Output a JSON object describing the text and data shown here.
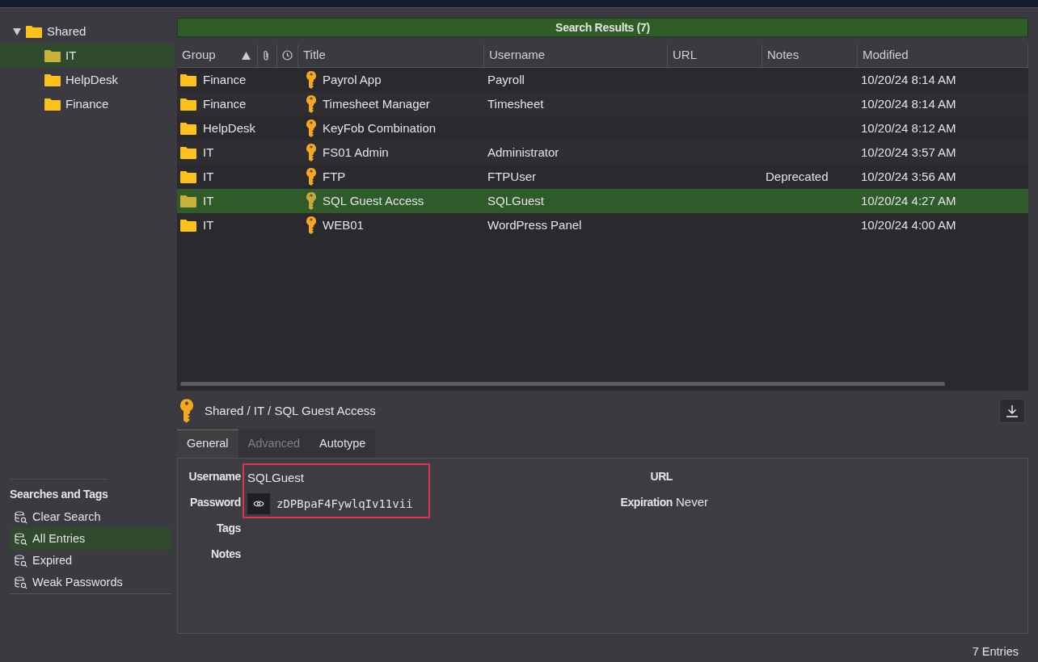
{
  "groups": [
    {
      "name": "Shared",
      "selected": false,
      "expanded": true,
      "children": [
        {
          "name": "IT",
          "selected": true
        },
        {
          "name": "HelpDesk",
          "selected": false
        },
        {
          "name": "Finance",
          "selected": false
        }
      ]
    }
  ],
  "searches": {
    "title": "Searches and Tags",
    "items": [
      {
        "label": "Clear Search",
        "selected": false
      },
      {
        "label": "All Entries",
        "selected": true
      },
      {
        "label": "Expired",
        "selected": false
      },
      {
        "label": "Weak Passwords",
        "selected": false
      }
    ]
  },
  "search_results": {
    "title": "Search Results (7)"
  },
  "table": {
    "columns": [
      {
        "kind": "text",
        "label": "Group",
        "sorted": true
      },
      {
        "kind": "attachment"
      },
      {
        "kind": "clock"
      },
      {
        "kind": "text",
        "label": "Title",
        "sorted": false
      },
      {
        "kind": "text",
        "label": "Username",
        "sorted": false
      },
      {
        "kind": "text",
        "label": "URL",
        "sorted": false
      },
      {
        "kind": "text",
        "label": "Notes",
        "sorted": false
      },
      {
        "kind": "text",
        "label": "Modified",
        "sorted": false
      }
    ],
    "rows": [
      {
        "group": "Finance",
        "title": "Payrol App",
        "username": "Payroll",
        "modified": "10/20/24 8:14 AM",
        "selected": false
      },
      {
        "group": "Finance",
        "title": "Timesheet Manager",
        "username": "Timesheet",
        "modified": "10/20/24 8:14 AM",
        "selected": false
      },
      {
        "group": "HelpDesk",
        "title": "KeyFob Combination",
        "modified": "10/20/24 8:12 AM",
        "selected": false
      },
      {
        "group": "IT",
        "title": "FS01 Admin",
        "username": "Administrator",
        "modified": "10/20/24 3:57 AM",
        "selected": false
      },
      {
        "group": "IT",
        "title": "FTP",
        "username": "FTPUser",
        "notes": "Deprecated",
        "modified": "10/20/24 3:56 AM",
        "selected": false
      },
      {
        "group": "IT",
        "title": "SQL Guest Access",
        "username": "SQLGuest",
        "modified": "10/20/24 4:27 AM",
        "selected": true
      },
      {
        "group": "IT",
        "title": "WEB01",
        "username": "WordPress Panel",
        "modified": "10/20/24 4:00 AM",
        "selected": false
      }
    ]
  },
  "detail": {
    "path": "Shared / IT / SQL Guest Access",
    "tabs": [
      {
        "label": "General",
        "selected": true,
        "disabled": false
      },
      {
        "label": "Advanced",
        "selected": false,
        "disabled": true
      },
      {
        "label": "Autotype",
        "selected": false,
        "disabled": false
      }
    ],
    "left_fields": [
      {
        "kind": "text",
        "label": "Username",
        "value": "SQLGuest",
        "highlighted": true
      },
      {
        "kind": "password",
        "label": "Password",
        "value": "zDPBpaF4FywlqIv11vii",
        "highlighted": true
      },
      {
        "kind": "text",
        "label": "Tags",
        "highlighted": false
      },
      {
        "kind": "text",
        "label": "Notes",
        "highlighted": false
      }
    ],
    "right_fields": [
      {
        "kind": "text",
        "label": "URL",
        "highlighted": false
      },
      {
        "kind": "text",
        "label": "Expiration",
        "value": "Never",
        "highlighted": false
      }
    ]
  },
  "status_bar": {
    "text": "7 Entries"
  }
}
